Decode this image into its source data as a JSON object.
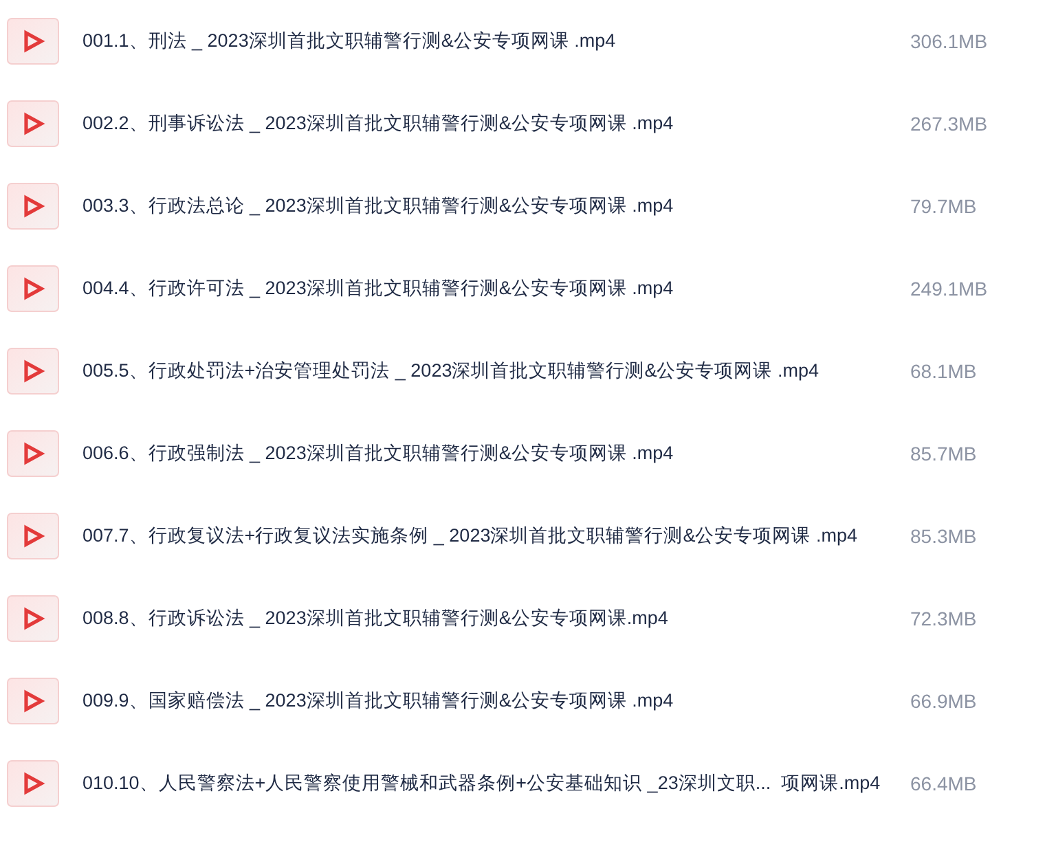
{
  "files": [
    {
      "name": "001.1、刑法 _ 2023深圳首批文职辅警行测&公安专项网课 .mp4",
      "size": "306.1MB"
    },
    {
      "name": "002.2、刑事诉讼法 _ 2023深圳首批文职辅警行测&公安专项网课 .mp4",
      "size": "267.3MB"
    },
    {
      "name": "003.3、行政法总论 _ 2023深圳首批文职辅警行测&公安专项网课 .mp4",
      "size": "79.7MB"
    },
    {
      "name": "004.4、行政许可法 _ 2023深圳首批文职辅警行测&公安专项网课 .mp4",
      "size": "249.1MB"
    },
    {
      "name": "005.5、行政处罚法+治安管理处罚法 _ 2023深圳首批文职辅警行测&公安专项网课 .mp4",
      "size": "68.1MB"
    },
    {
      "name": "006.6、行政强制法 _ 2023深圳首批文职辅警行测&公安专项网课 .mp4",
      "size": "85.7MB"
    },
    {
      "name": "007.7、行政复议法+行政复议法实施条例 _ 2023深圳首批文职辅警行测&公安专项网课 .mp4",
      "size": "85.3MB"
    },
    {
      "name": "008.8、行政诉讼法 _ 2023深圳首批文职辅警行测&公安专项网课.mp4",
      "size": "72.3MB"
    },
    {
      "name": "009.9、国家赔偿法 _ 2023深圳首批文职辅警行测&公安专项网课 .mp4",
      "size": "66.9MB"
    },
    {
      "name": "010.10、人民警察法+人民警察使用警械和武器条例+公安基础知识 _23深圳文职...  项网课.mp4",
      "size": "66.4MB"
    }
  ]
}
